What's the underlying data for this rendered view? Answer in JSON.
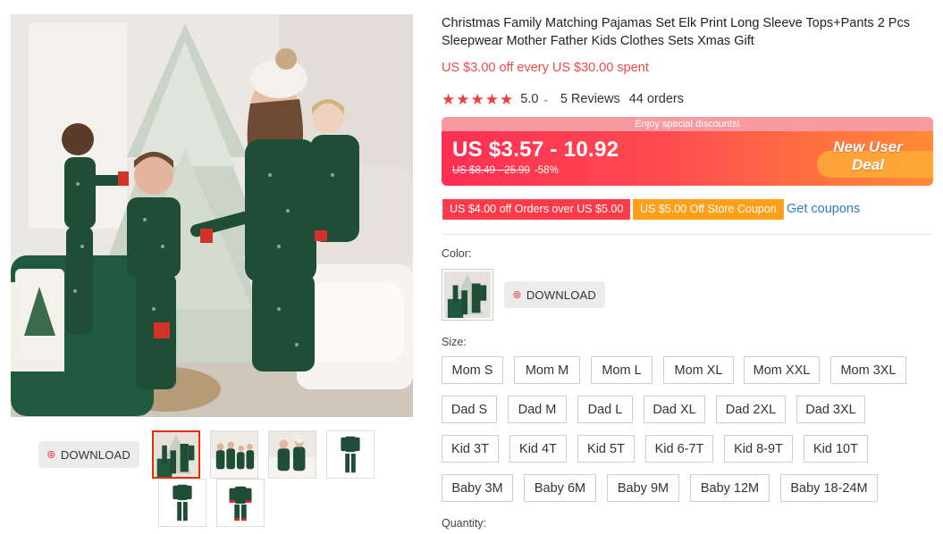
{
  "product": {
    "title": "Christmas Family Matching Pajamas Set Elk Print Long Sleeve Tops+Pants 2 Pcs Sleepwear Mother Father Kids Clothes Sets Xmas Gift",
    "spend_offer": "US $3.00 off every US $30.00 spent",
    "rating": {
      "stars": 5,
      "value": "5.0",
      "reviews": "5 Reviews",
      "orders": "44 orders"
    }
  },
  "price_banner": {
    "top_text": "Enjoy special discounts!",
    "price": "US $3.57 - 10.92",
    "original_price": "US $8.49 - 25.99",
    "discount": "-58%",
    "badge_line1": "New User",
    "badge_line2": "Deal"
  },
  "coupons": {
    "coupon1": "US $4.00 off Orders over US $5.00",
    "coupon2": "US $5.00 Off Store Coupon",
    "get_coupons": "Get coupons"
  },
  "download_label": "DOWNLOAD",
  "labels": {
    "color": "Color:",
    "size": "Size:",
    "quantity": "Quantity:"
  },
  "sizes": {
    "row1": [
      "Mom S",
      "Mom M",
      "Mom L",
      "Mom XL",
      "Mom XXL",
      "Mom 3XL"
    ],
    "row2": [
      "Dad S",
      "Dad M",
      "Dad L",
      "Dad XL",
      "Dad 2XL",
      "Dad 3XL"
    ],
    "row3": [
      "Kid 3T",
      "Kid 4T",
      "Kid 5T",
      "Kid 6-7T",
      "Kid 8-9T",
      "Kid 10T"
    ],
    "row4": [
      "Baby 3M",
      "Baby 6M",
      "Baby 9M",
      "Baby 12M",
      "Baby 18-24M"
    ]
  },
  "colors": {
    "accent_red": "#f04a4a",
    "link_blue": "#2b7ec1",
    "coupon_red": "#ff3b4a",
    "coupon_orange": "#ff9f1a",
    "pajama_green": "#1f4d36"
  },
  "icons": {
    "download": "target-icon",
    "star": "star-icon",
    "chevron": "chevron-down-icon"
  }
}
